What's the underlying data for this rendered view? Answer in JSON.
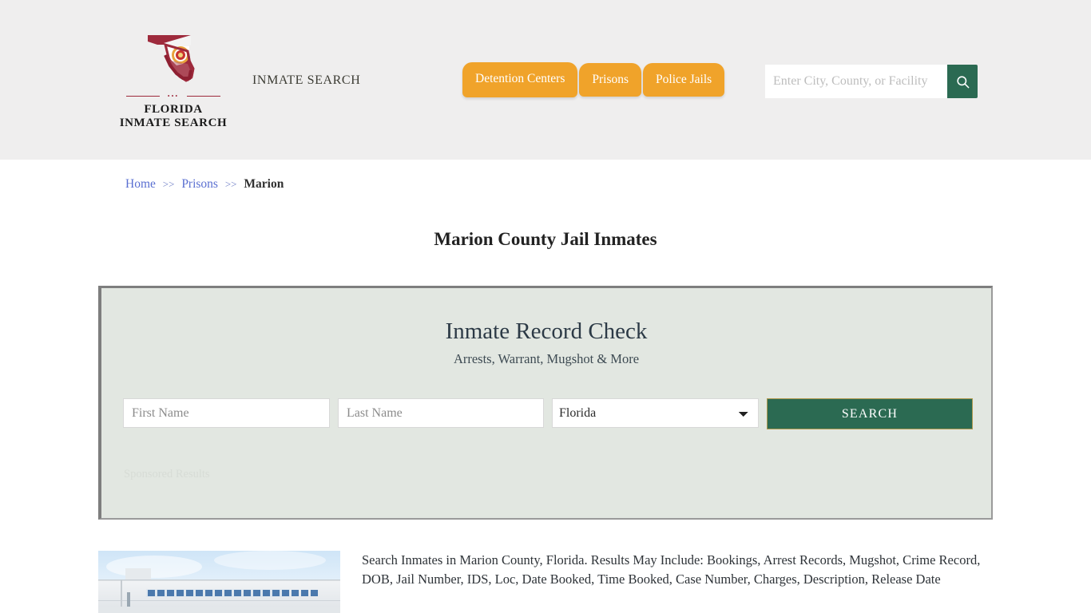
{
  "header": {
    "logo": {
      "icon": "florida-map-icon",
      "line1": "FLORIDA",
      "line2": "INMATE SEARCH"
    },
    "tagline": "INMATE SEARCH",
    "nav": [
      {
        "label": "Detention Centers"
      },
      {
        "label": "Prisons"
      },
      {
        "label": "Police Jails"
      }
    ],
    "search": {
      "placeholder": "Enter City, County, or Facility",
      "value": "",
      "button_icon": "search-icon"
    },
    "colors": {
      "background": "#efeeee",
      "nav_orange": "#f0a32a",
      "green": "#2b6a52"
    }
  },
  "breadcrumb": {
    "items": [
      {
        "label": "Home",
        "link": true
      },
      {
        "label": "Prisons",
        "link": true
      },
      {
        "label": "Marion",
        "link": false
      }
    ],
    "separator": ">>"
  },
  "page": {
    "title": "Marion County Jail Inmates"
  },
  "widget": {
    "title": "Inmate Record Check",
    "subtitle": "Arrests, Warrant, Mugshot & More",
    "form": {
      "first_name_placeholder": "First Name",
      "first_name_value": "",
      "last_name_placeholder": "Last Name",
      "last_name_value": "",
      "state_selected": "Florida",
      "state_options": [
        "Florida"
      ],
      "search_button": "SEARCH"
    },
    "sponsored_label": "Sponsored Results",
    "colors": {
      "box_background": "#e2e7e1",
      "button_green": "#2b6a52"
    }
  },
  "result": {
    "thumbnail_icon": "jail-building-photo",
    "description": "Search Inmates in Marion County, Florida. Results May Include: Bookings, Arrest Records, Mugshot, Crime Record, DOB, Jail Number, IDS, Loc, Date Booked, Time Booked, Case Number, Charges, Description, Release Date"
  }
}
